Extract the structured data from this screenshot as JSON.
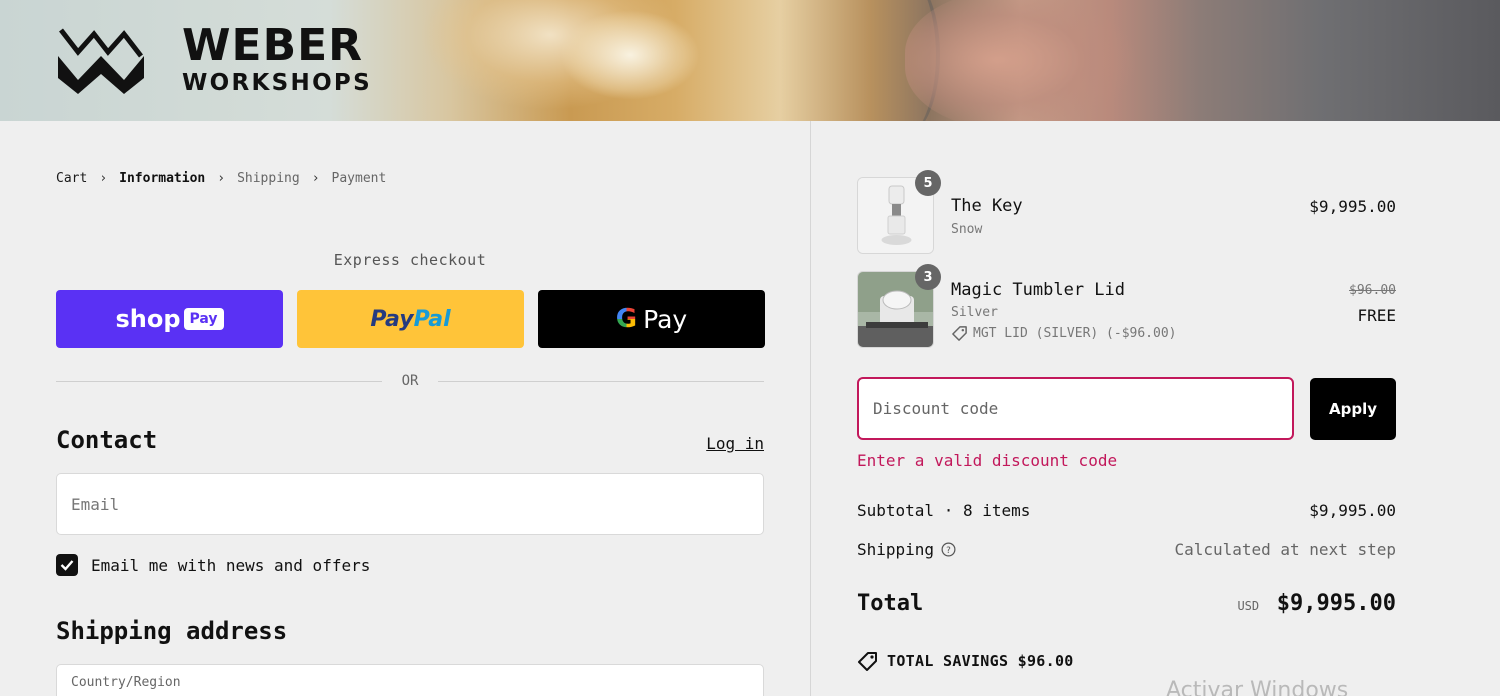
{
  "brand": {
    "line1": "WEBER",
    "line2": "WORKSHOPS"
  },
  "breadcrumb": [
    {
      "label": "Cart",
      "state": "link"
    },
    {
      "label": "Information",
      "state": "current"
    },
    {
      "label": "Shipping",
      "state": "upcoming"
    },
    {
      "label": "Payment",
      "state": "upcoming"
    }
  ],
  "express": {
    "title": "Express checkout",
    "shop_pay": {
      "word": "shop",
      "pill": "Pay"
    },
    "paypal": {
      "part1": "Pay",
      "part2": "Pal"
    },
    "gpay": {
      "g": "G",
      "word": "Pay"
    },
    "or": "OR"
  },
  "contact": {
    "heading": "Contact",
    "login": "Log in",
    "email_placeholder": "Email",
    "email_value": "",
    "newsletter_label": "Email me with news and offers",
    "newsletter_checked": true
  },
  "shipping_address": {
    "heading": "Shipping address",
    "country_label": "Country/Region"
  },
  "order": {
    "items": [
      {
        "name": "The Key",
        "variant": "Snow",
        "quantity": "5",
        "price": "$9,995.00",
        "discount": "",
        "original_price": ""
      },
      {
        "name": "Magic Tumbler Lid",
        "variant": "Silver",
        "quantity": "3",
        "price": "FREE",
        "discount": "MGT LID (SILVER) (-$96.00)",
        "original_price": "$96.00"
      }
    ],
    "discount": {
      "placeholder": "Discount code",
      "apply_label": "Apply",
      "error": "Enter a valid discount code"
    },
    "subtotal_label": "Subtotal · 8 items",
    "subtotal_value": "$9,995.00",
    "shipping_label": "Shipping",
    "shipping_value": "Calculated at next step",
    "total_label": "Total",
    "total_currency": "USD",
    "total_value": "$9,995.00",
    "savings": "TOTAL SAVINGS $96.00"
  },
  "colors": {
    "accent_error": "#c2185b",
    "shop_pay": "#5a31f4",
    "paypal": "#ffc439"
  },
  "watermark": "Activar Windows"
}
